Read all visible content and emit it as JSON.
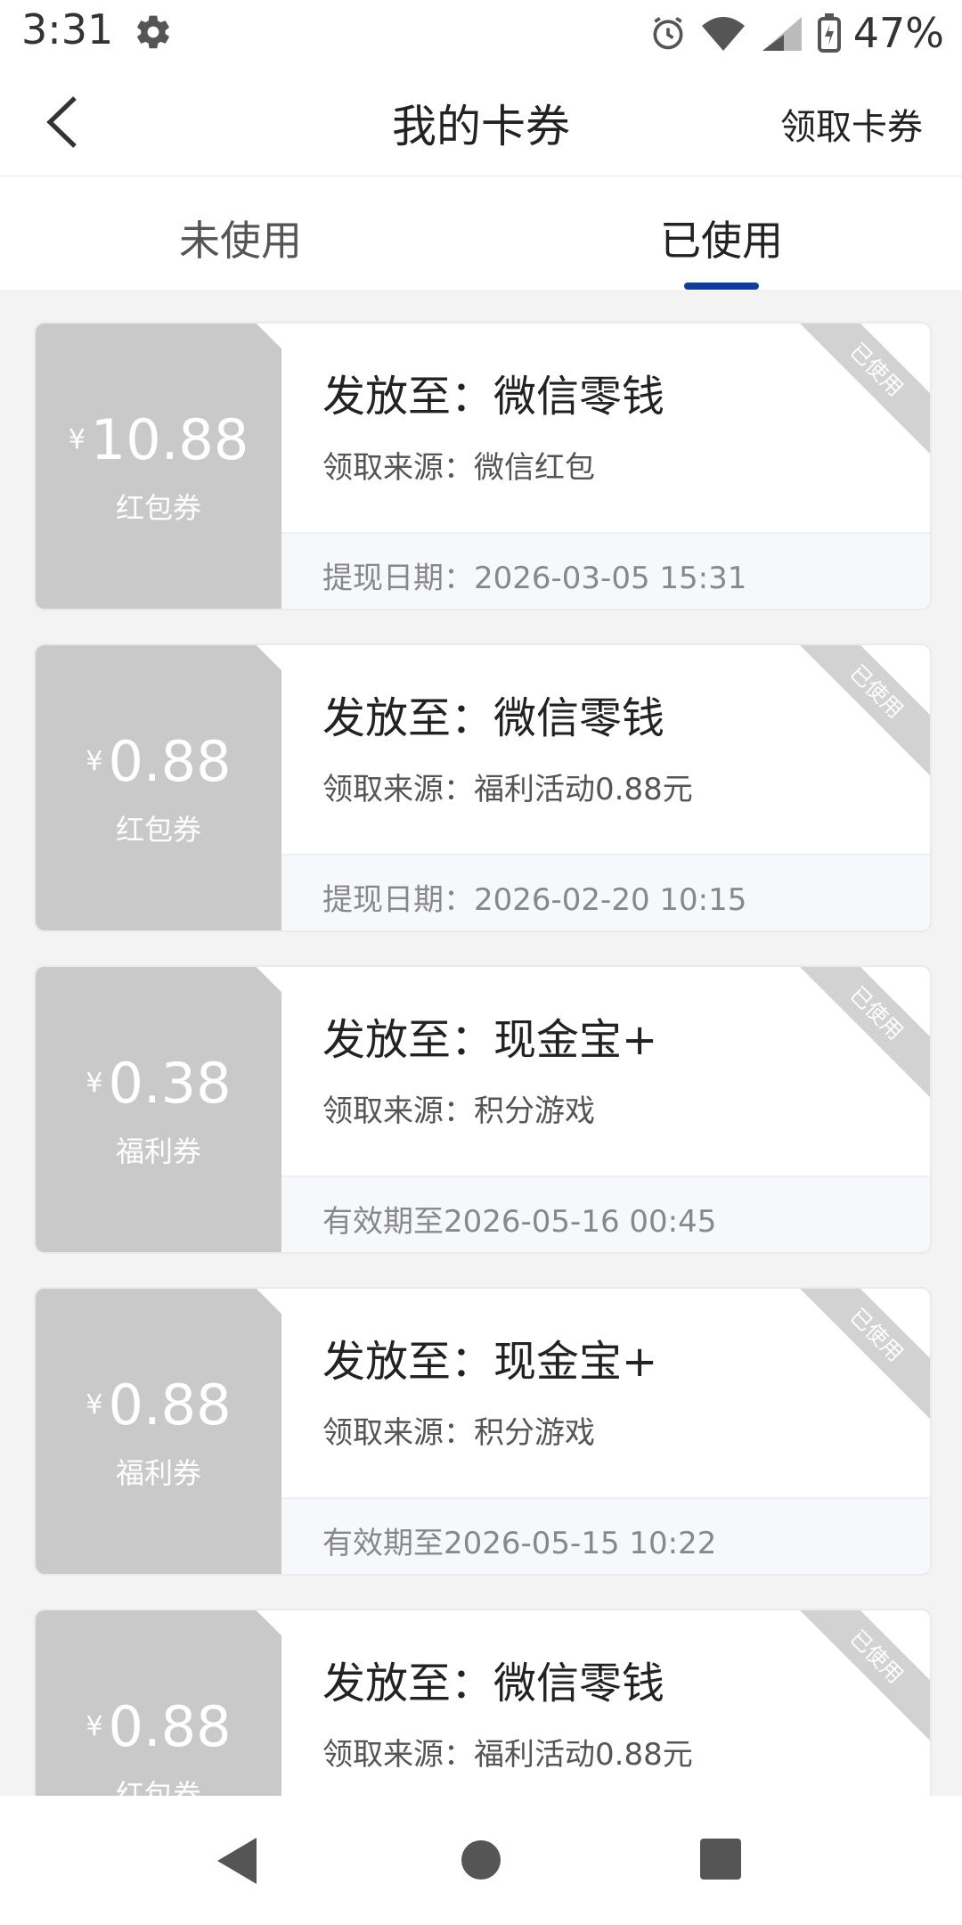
{
  "status_bar": {
    "time": "3:31",
    "battery": "47%",
    "icons": [
      "gear-icon",
      "alarm-icon",
      "wifi-icon",
      "signal-icon",
      "battery-icon"
    ]
  },
  "header": {
    "title": "我的卡券",
    "action": "领取卡券",
    "back_icon": "chevron-left-icon"
  },
  "tabs": [
    {
      "label": "未使用",
      "active": false
    },
    {
      "label": "已使用",
      "active": true
    }
  ],
  "coupons": [
    {
      "currency": "¥",
      "amount": "10.88",
      "type": "红包券",
      "destination": "发放至：微信零钱",
      "source": "领取来源：微信红包",
      "footer": "提现日期：2026-03-05 15:31",
      "badge": "已使用"
    },
    {
      "currency": "¥",
      "amount": "0.88",
      "type": "红包券",
      "destination": "发放至：微信零钱",
      "source": "领取来源：福利活动0.88元",
      "footer": "提现日期：2026-02-20 10:15",
      "badge": "已使用"
    },
    {
      "currency": "¥",
      "amount": "0.38",
      "type": "福利券",
      "destination": "发放至：现金宝+",
      "source": "领取来源：积分游戏",
      "footer": "有效期至2026-05-16 00:45",
      "badge": "已使用"
    },
    {
      "currency": "¥",
      "amount": "0.88",
      "type": "福利券",
      "destination": "发放至：现金宝+",
      "source": "领取来源：积分游戏",
      "footer": "有效期至2026-05-15 10:22",
      "badge": "已使用"
    },
    {
      "currency": "¥",
      "amount": "0.88",
      "type": "红包券",
      "destination": "发放至：微信零钱",
      "source": "领取来源：福利活动0.88元",
      "footer": "",
      "badge": "已使用"
    }
  ],
  "nav_bar": {
    "icons": [
      "back-triangle-icon",
      "home-circle-icon",
      "recents-square-icon"
    ]
  },
  "colors": {
    "accent": "#0b3f9a",
    "coupon_left_bg": "#c9c9c9",
    "background": "#f3f3f3"
  }
}
